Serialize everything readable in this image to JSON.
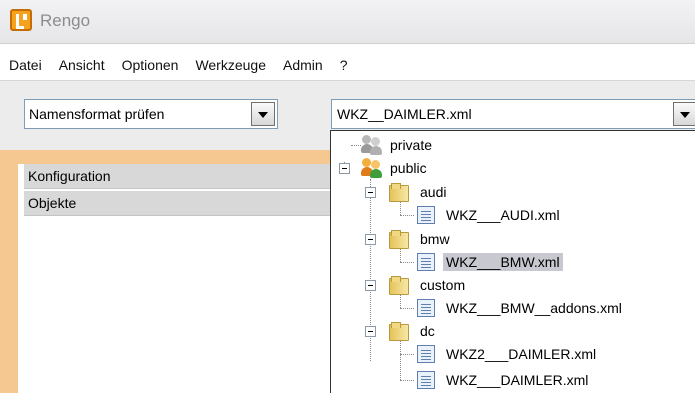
{
  "window": {
    "title": "Rengo",
    "icon": "rengo-app-icon"
  },
  "menu": [
    "Datei",
    "Ansicht",
    "Optionen",
    "Werkzeuge",
    "Admin",
    "?"
  ],
  "toolbar": {
    "action_combo_value": "Namensformat prüfen",
    "file_combo_value": "WKZ__DAIMLER.xml"
  },
  "left_panel": {
    "headers": [
      "Konfiguration",
      "Objekte"
    ]
  },
  "tree": {
    "private": "private",
    "public": "public",
    "audi": "audi",
    "audi_file": "WKZ___AUDI.xml",
    "bmw": "bmw",
    "bmw_file": "WKZ___BMW.xml",
    "custom": "custom",
    "custom_file": "WKZ___BMW__addons.xml",
    "dc": "dc",
    "dc_file_1": "WKZ2___DAIMLER.xml",
    "dc_file_2": "WKZ___DAIMLER.xml",
    "selected": "WKZ___BMW.xml"
  },
  "colors": {
    "accent_orange": "#f5c892",
    "selection": "#c8c8d0"
  }
}
